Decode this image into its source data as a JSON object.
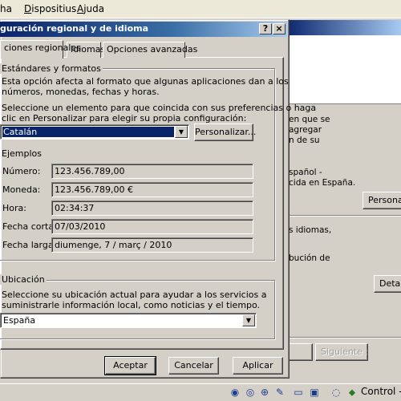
{
  "menubar": {
    "items": [
      {
        "label": "ha",
        "accel": ""
      },
      {
        "label": "Dispositius",
        "accel": "D"
      },
      {
        "label": "Ajuda",
        "accel": "A"
      }
    ]
  },
  "dialog": {
    "title": "guración regional y de idioma",
    "help_button": "?",
    "close_button": "×",
    "tabs": [
      {
        "label": "ciones regionales",
        "active": true
      },
      {
        "label": "Idiomas",
        "active": false
      },
      {
        "label": "Opciones avanzadas",
        "active": false
      }
    ],
    "standards_group": {
      "label": "Estándares y formatos",
      "desc_line1": "Esta opción afecta al formato que algunas aplicaciones dan a los",
      "desc_line2": "números, monedas, fechas y horas.",
      "select_line1": "Seleccione un elemento para que coincida con sus preferencias o haga",
      "select_line2": "clic en Personalizar para elegir su propia configuración:",
      "format_value": "Catalán",
      "customize_button": "Personalizar..."
    },
    "examples": {
      "label": "Ejemplos",
      "rows": [
        {
          "label": "Número:",
          "value": "123.456.789,00"
        },
        {
          "label": "Moneda:",
          "value": "123.456.789,00 €"
        },
        {
          "label": "Hora:",
          "value": "02:34:37"
        },
        {
          "label": "Fecha corta:",
          "value": "07/03/2010"
        },
        {
          "label": "Fecha larga:",
          "value": "diumenge, 7 / març / 2010"
        }
      ]
    },
    "location_group": {
      "label": "Ubicación",
      "desc_line1": "Seleccione su ubicación actual para ayudar a los servicios a",
      "desc_line2": "suministrarle información local, como noticias y el tiempo.",
      "location_value": "España"
    },
    "buttons": {
      "accept": "Aceptar",
      "cancel": "Cancelar",
      "apply": "Aplicar"
    }
  },
  "background_window": {
    "text_lines": [
      "en que se",
      "agregar",
      "n de su",
      "spañol -",
      "cida en España.",
      "s idiomas,",
      "bución de"
    ],
    "personalize_button": "Personali",
    "details_button": "Detalle",
    "next_button": "Siguiente >"
  },
  "taskbar": {
    "control_label": "Control -"
  },
  "colors": {
    "titlebar_active": "#0a246a",
    "titlebar_gradient_end": "#a6caf0",
    "window_face": "#d4d0c8",
    "selection": "#0a246a"
  }
}
